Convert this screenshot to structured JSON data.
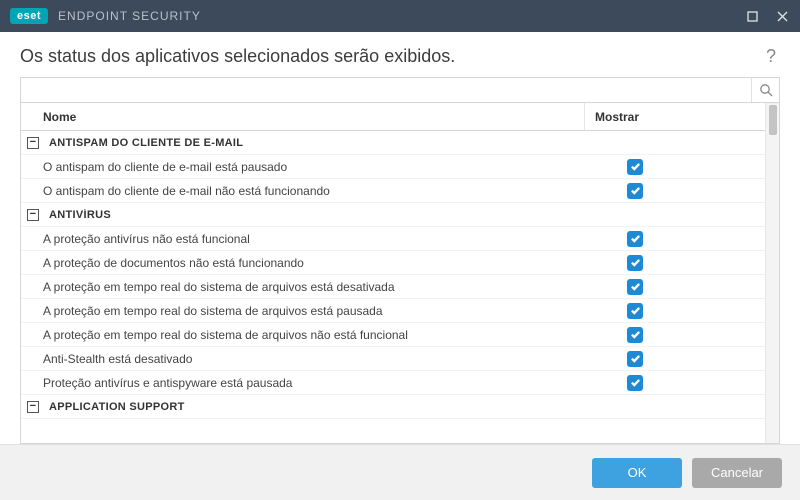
{
  "app": {
    "brand": "eset",
    "title": "ENDPOINT SECURITY"
  },
  "page": {
    "title": "Os status dos aplicativos selecionados serão exibidos.",
    "search_placeholder": ""
  },
  "columns": {
    "name": "Nome",
    "show": "Mostrar"
  },
  "groups": [
    {
      "label": "ANTISPAM DO CLIENTE DE E-MAIL",
      "expanded": true,
      "items": [
        {
          "label": "O antispam do cliente de e-mail está pausado",
          "checked": true
        },
        {
          "label": "O antispam do cliente de e-mail não está funcionando",
          "checked": true
        }
      ]
    },
    {
      "label": "ANTIVÍRUS",
      "expanded": true,
      "items": [
        {
          "label": "A proteção antivírus não está funcional",
          "checked": true
        },
        {
          "label": "A proteção de documentos não está funcionando",
          "checked": true
        },
        {
          "label": "A proteção em tempo real do sistema de arquivos está desativada",
          "checked": true
        },
        {
          "label": "A proteção em tempo real do sistema de arquivos está pausada",
          "checked": true
        },
        {
          "label": "A proteção em tempo real do sistema de arquivos não está funcional",
          "checked": true
        },
        {
          "label": "Anti-Stealth está desativado",
          "checked": true
        },
        {
          "label": "Proteção antivírus e antispyware está pausada",
          "checked": true
        }
      ]
    },
    {
      "label": "APPLICATION SUPPORT",
      "expanded": true,
      "items": []
    }
  ],
  "footer": {
    "ok": "OK",
    "cancel": "Cancelar"
  },
  "icons": {
    "collapse": "−"
  }
}
